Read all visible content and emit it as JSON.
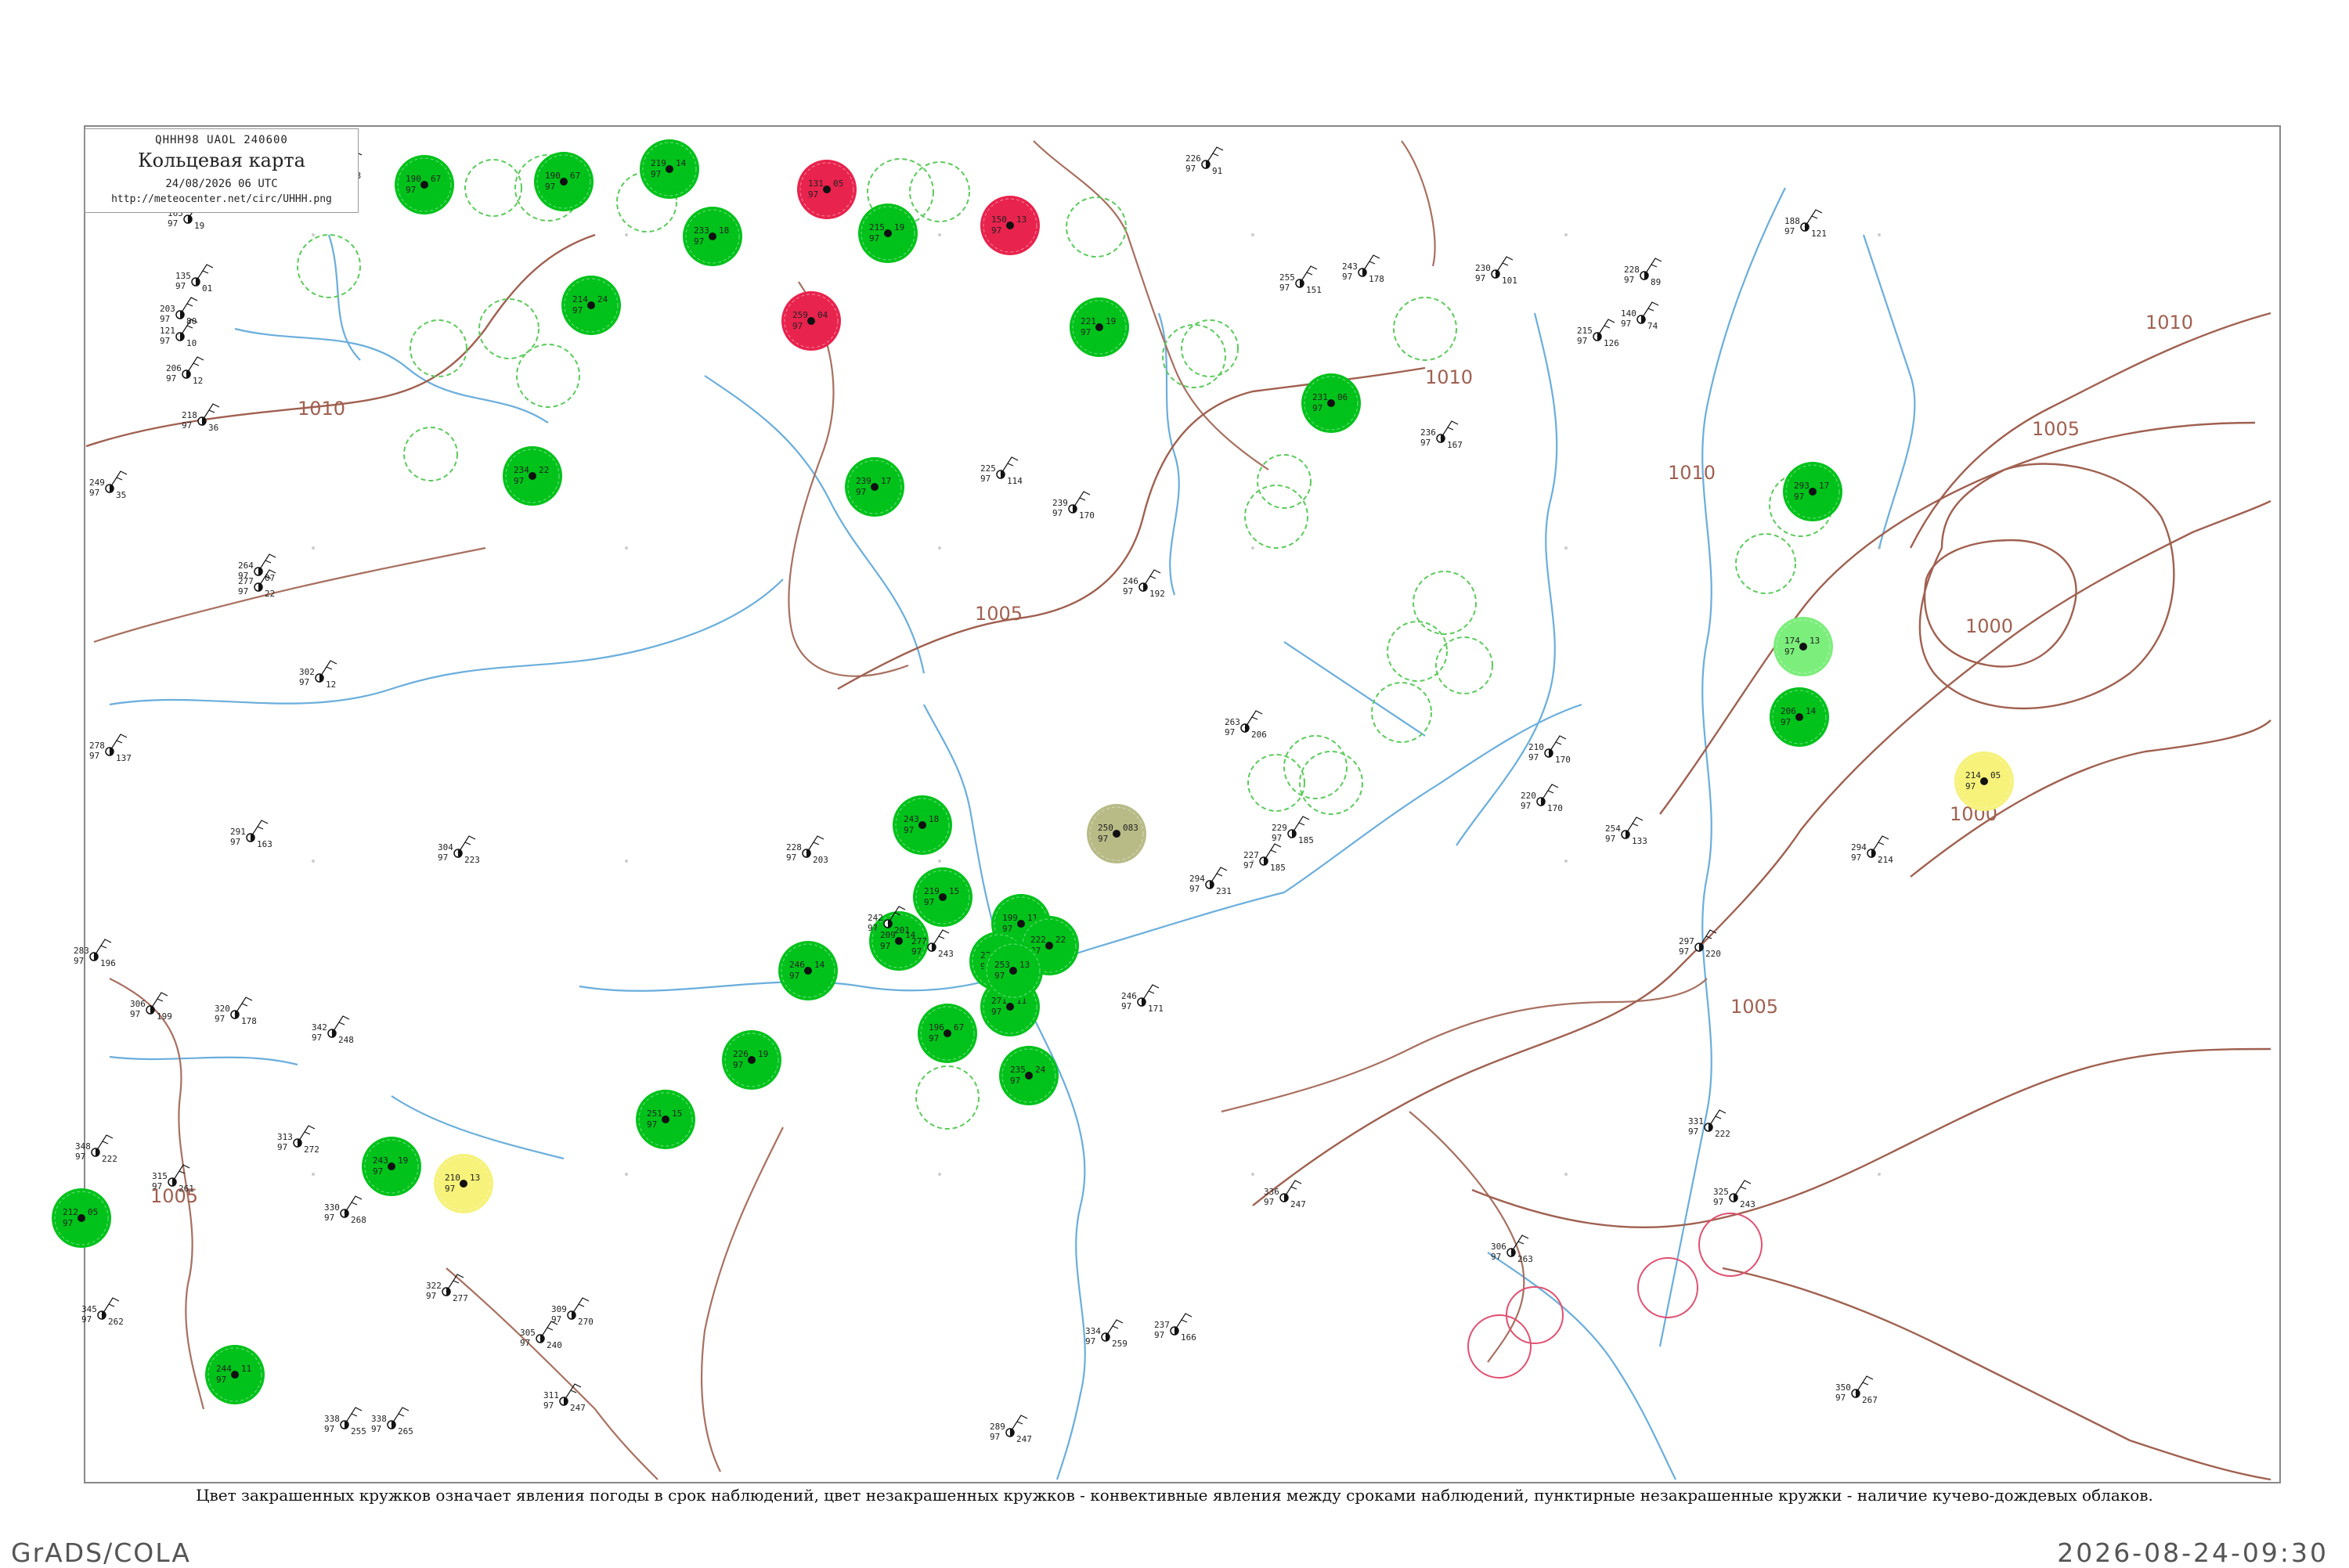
{
  "map": {
    "header_code": "QHHH98  UAOL  240600",
    "title": "Кольцевая карта",
    "datetime": "24/08/2026 06 UTC",
    "url": "http://meteocenter.net/circ/UHHH.png"
  },
  "isobars": [
    "1010",
    "1010",
    "1005",
    "1005",
    "1000",
    "1010",
    "1010",
    "1005",
    "1000",
    "1005"
  ],
  "colors": {
    "heavy_precip": "#00c21a",
    "light_precip": "#7bee7b",
    "thunder": "#e8234d",
    "fog": "#f6f27a",
    "haze": "#b8bb86",
    "rivers": "#6aaedc",
    "borders": "#a87060",
    "isobars": "#a06050"
  },
  "stations": [
    {
      "t": "163",
      "d": "97",
      "p": "19"
    },
    {
      "t": "227",
      "d": "97",
      "p": "13"
    },
    {
      "t": "135",
      "d": "97",
      "p": "01"
    },
    {
      "t": "121",
      "d": "97",
      "p": "10"
    },
    {
      "t": "203",
      "d": "97",
      "p": "80"
    },
    {
      "t": "206",
      "d": "97",
      "p": "12"
    },
    {
      "t": "218",
      "d": "97",
      "p": "36"
    },
    {
      "t": "249",
      "d": "97",
      "p": "35"
    },
    {
      "t": "264",
      "d": "97",
      "p": "07"
    },
    {
      "t": "277",
      "d": "97",
      "p": "22"
    },
    {
      "t": "302",
      "d": "97",
      "p": "12"
    },
    {
      "t": "278",
      "d": "97",
      "p": "137"
    },
    {
      "t": "291",
      "d": "97",
      "p": "163"
    },
    {
      "t": "283",
      "d": "97",
      "p": "196"
    },
    {
      "t": "306",
      "d": "97",
      "p": "199"
    },
    {
      "t": "320",
      "d": "97",
      "p": "178"
    },
    {
      "t": "342",
      "d": "97",
      "p": "248"
    },
    {
      "t": "313",
      "d": "97",
      "p": "272"
    },
    {
      "t": "348",
      "d": "97",
      "p": "222"
    },
    {
      "t": "315",
      "d": "97",
      "p": "261"
    },
    {
      "t": "330",
      "d": "97",
      "p": "268"
    },
    {
      "t": "345",
      "d": "97",
      "p": "262"
    },
    {
      "t": "226",
      "d": "97",
      "p": "91"
    },
    {
      "t": "255",
      "d": "97",
      "p": "151"
    },
    {
      "t": "243",
      "d": "97",
      "p": "178"
    },
    {
      "t": "230",
      "d": "97",
      "p": "101"
    },
    {
      "t": "228",
      "d": "97",
      "p": "89"
    },
    {
      "t": "188",
      "d": "97",
      "p": "121"
    },
    {
      "t": "215",
      "d": "97",
      "p": "126"
    },
    {
      "t": "263",
      "d": "97",
      "p": "206"
    },
    {
      "t": "294",
      "d": "97",
      "p": "231"
    },
    {
      "t": "277",
      "d": "97",
      "p": "243"
    },
    {
      "t": "336",
      "d": "97",
      "p": "247"
    },
    {
      "t": "304",
      "d": "97",
      "p": "223"
    },
    {
      "t": "228",
      "d": "97",
      "p": "203"
    },
    {
      "t": "242",
      "d": "97",
      "p": "201"
    },
    {
      "t": "246",
      "d": "97",
      "p": "171"
    },
    {
      "t": "227",
      "d": "97",
      "p": "185"
    },
    {
      "t": "229",
      "d": "97",
      "p": "185"
    },
    {
      "t": "210",
      "d": "97",
      "p": "170"
    },
    {
      "t": "220",
      "d": "97",
      "p": "170"
    },
    {
      "t": "294",
      "d": "97",
      "p": "214"
    },
    {
      "t": "297",
      "d": "97",
      "p": "220"
    },
    {
      "t": "331",
      "d": "97",
      "p": "222"
    },
    {
      "t": "325",
      "d": "97",
      "p": "243"
    },
    {
      "t": "350",
      "d": "97",
      "p": "267"
    },
    {
      "t": "322",
      "d": "97",
      "p": "277"
    },
    {
      "t": "309",
      "d": "97",
      "p": "270"
    },
    {
      "t": "338",
      "d": "97",
      "p": "255"
    },
    {
      "t": "338",
      "d": "97",
      "p": "265"
    },
    {
      "t": "305",
      "d": "97",
      "p": "240"
    },
    {
      "t": "311",
      "d": "97",
      "p": "247"
    },
    {
      "t": "289",
      "d": "97",
      "p": "247"
    },
    {
      "t": "334",
      "d": "97",
      "p": "259"
    },
    {
      "t": "306",
      "d": "97",
      "p": "263"
    },
    {
      "t": "237",
      "d": "97",
      "p": "166"
    },
    {
      "t": "236",
      "d": "97",
      "p": "167"
    },
    {
      "t": "246",
      "d": "97",
      "p": "192"
    },
    {
      "t": "239",
      "d": "97",
      "p": "170"
    },
    {
      "t": "225",
      "d": "97",
      "p": "114"
    },
    {
      "t": "140",
      "d": "97",
      "p": "74"
    },
    {
      "t": "254",
      "d": "97",
      "p": "133"
    }
  ],
  "precip_circles": [
    {
      "kind": "heavy",
      "t": "190",
      "p": "67"
    },
    {
      "kind": "heavy",
      "t": "190",
      "p": "67"
    },
    {
      "kind": "heavy",
      "t": "219",
      "p": "14"
    },
    {
      "kind": "heavy",
      "t": "233",
      "p": "18"
    },
    {
      "kind": "heavy",
      "t": "214",
      "p": "24"
    },
    {
      "kind": "heavy",
      "t": "215",
      "p": "19"
    },
    {
      "kind": "heavy",
      "t": "234",
      "p": "22"
    },
    {
      "kind": "heavy",
      "t": "221",
      "p": "19"
    },
    {
      "kind": "heavy",
      "t": "231",
      "p": "06"
    },
    {
      "kind": "heavy",
      "t": "239",
      "p": "17"
    },
    {
      "kind": "heavy",
      "t": "206",
      "p": "14"
    },
    {
      "kind": "heavy",
      "t": "243",
      "p": "18"
    },
    {
      "kind": "heavy",
      "t": "219",
      "p": "15"
    },
    {
      "kind": "heavy",
      "t": "196",
      "p": "67"
    },
    {
      "kind": "heavy",
      "t": "199",
      "p": "11"
    },
    {
      "kind": "heavy",
      "t": "209",
      "p": "14"
    },
    {
      "kind": "heavy",
      "t": "222",
      "p": "22"
    },
    {
      "kind": "heavy",
      "t": "272",
      "p": "13"
    },
    {
      "kind": "heavy",
      "t": "271",
      "p": "11"
    },
    {
      "kind": "heavy",
      "t": "235",
      "p": "24"
    },
    {
      "kind": "heavy",
      "t": "246",
      "p": "14"
    },
    {
      "kind": "heavy",
      "t": "226",
      "p": "19"
    },
    {
      "kind": "heavy",
      "t": "251",
      "p": "15"
    },
    {
      "kind": "heavy",
      "t": "243",
      "p": "19"
    },
    {
      "kind": "heavy",
      "t": "293",
      "p": "17"
    },
    {
      "kind": "heavy",
      "t": "212",
      "p": "05"
    },
    {
      "kind": "heavy",
      "t": "244",
      "p": "11"
    },
    {
      "kind": "heavy",
      "t": "253",
      "p": "13"
    },
    {
      "kind": "light",
      "t": "174",
      "p": "13"
    },
    {
      "kind": "thunder",
      "t": "131",
      "p": "05"
    },
    {
      "kind": "thunder",
      "t": "150",
      "p": "13"
    },
    {
      "kind": "thunder",
      "t": "259",
      "p": "04"
    },
    {
      "kind": "fog",
      "t": "210",
      "p": "13"
    },
    {
      "kind": "fog",
      "t": "214",
      "p": "05"
    },
    {
      "kind": "haze",
      "t": "250",
      "p": "083"
    }
  ],
  "caption": "Цвет закрашенных кружков означает явления погоды в срок наблюдений, цвет незакрашенных кружков - конвективные явления между сроками наблюдений, пунктирные незакрашенные кружки - наличие кучево-дождевых облаков.",
  "footer": {
    "left": "GrADS/COLA",
    "right": "2026-08-24-09:30"
  }
}
